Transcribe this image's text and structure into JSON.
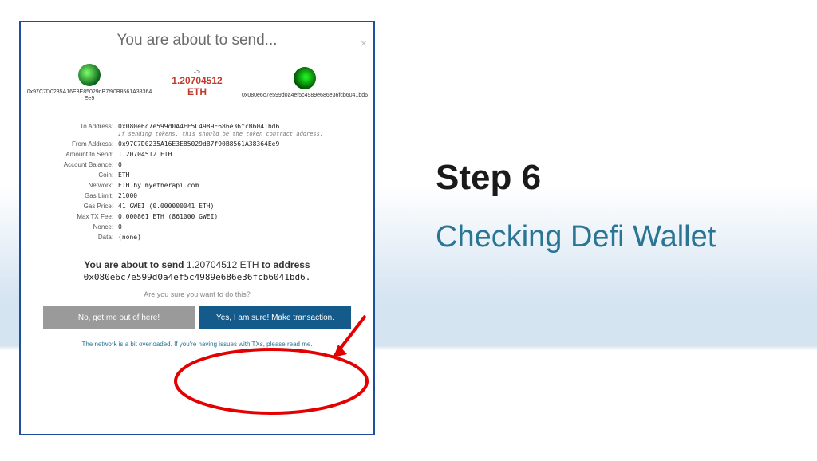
{
  "step": {
    "title": "Step 6",
    "subtitle": "Checking Defi Wallet"
  },
  "modal": {
    "title": "You are about to send...",
    "close": "×",
    "from_addr": "0x97C7D0235A16E3E85029dB7f90B8561A38364Ee9",
    "to_addr": "0x080e6c7e599d0a4ef5c4989e686e36fcb6041bd6",
    "center_arrow": "->",
    "amount_display": "1.20704512",
    "amount_unit": "ETH",
    "details": {
      "to_label": "To Address:",
      "to_val": "0x080e6c7e599d0A4EF5C4989E686e36fcB6041bd6",
      "to_note": "If sending tokens, this should be the token contract address.",
      "from_label": "From Address:",
      "from_val": "0x97C7D0235A16E3E85029dB7f90B8561A38364Ee9",
      "amount_label": "Amount to Send:",
      "amount_val": "1.20704512 ETH",
      "balance_label": "Account Balance:",
      "balance_val": "0",
      "coin_label": "Coin:",
      "coin_val": "ETH",
      "network_label": "Network:",
      "network_val": "ETH by myetherapi.com",
      "gaslimit_label": "Gas Limit:",
      "gaslimit_val": "21000",
      "gasprice_label": "Gas Price:",
      "gasprice_val": "41 GWEI (0.000000041 ETH)",
      "maxfee_label": "Max TX Fee:",
      "maxfee_val": "0.000861 ETH (861000 GWEI)",
      "nonce_label": "Nonce:",
      "nonce_val": "0",
      "data_label": "Data:",
      "data_val": "(none)"
    },
    "confirm": {
      "pre": "You are about to send",
      "amount": "1.20704512  ETH",
      "post": "to address",
      "addr": "0x080e6c7e599d0a4ef5c4989e686e36fcb6041bd6.",
      "question": "Are you sure you want to do this?",
      "no": "No, get me out of here!",
      "yes": "Yes, I am sure! Make transaction."
    },
    "footer": "The network is a bit overloaded. If you're having issues with TXs, please read me."
  }
}
